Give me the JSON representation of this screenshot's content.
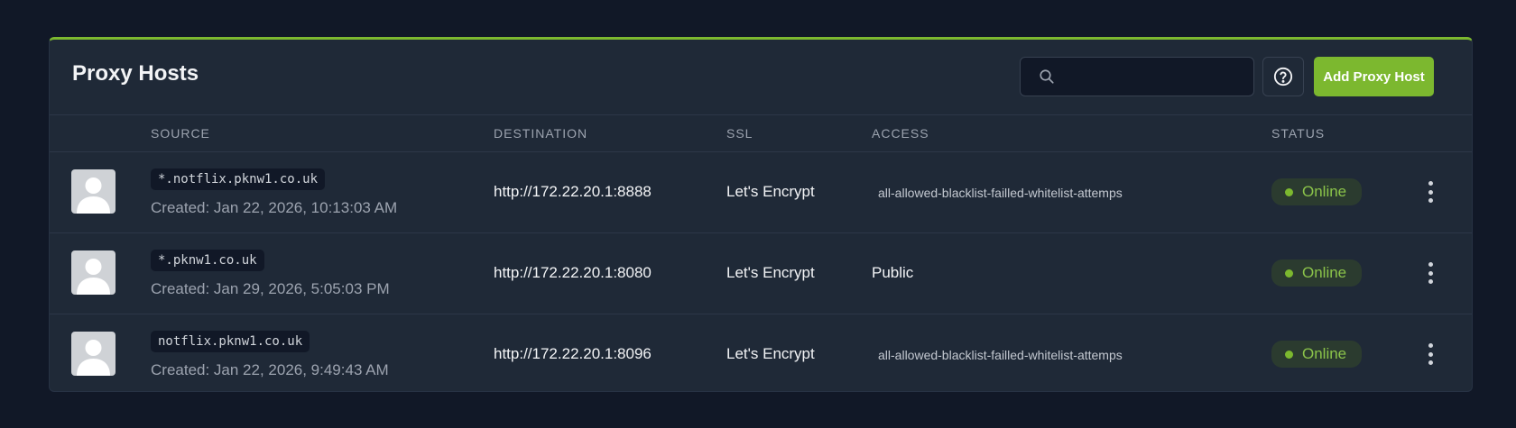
{
  "page": {
    "title": "Proxy Hosts",
    "search_placeholder": "",
    "add_button_label": "Add Proxy Host"
  },
  "table": {
    "headers": {
      "source": "SOURCE",
      "destination": "DESTINATION",
      "ssl": "SSL",
      "access": "ACCESS",
      "status": "STATUS"
    },
    "rows": [
      {
        "domain": "*.notflix.pknw1.co.uk",
        "created": "Created: Jan 22, 2026, 10:13:03 AM",
        "destination": "http://172.22.20.1:8888",
        "ssl": "Let's Encrypt",
        "access": "all-allowed-blacklist-failled-whitelist-attemps",
        "status": "Online"
      },
      {
        "domain": "*.pknw1.co.uk",
        "created": "Created: Jan 29, 2026, 5:05:03 PM",
        "destination": "http://172.22.20.1:8080",
        "ssl": "Let's Encrypt",
        "access": "Public",
        "status": "Online"
      },
      {
        "domain": "notflix.pknw1.co.uk",
        "created": "Created: Jan 22, 2026, 9:49:43 AM",
        "destination": "http://172.22.20.1:8096",
        "ssl": "Let's Encrypt",
        "access": "all-allowed-blacklist-failled-whitelist-attemps",
        "status": "Online"
      }
    ]
  },
  "colors": {
    "accent": "#7cb82f",
    "background": "#111827",
    "card": "#1f2937",
    "status_online": "#8bc34a"
  },
  "icons": {
    "search": "search-icon",
    "help": "help-circle-icon",
    "row_menu": "more-vertical-icon",
    "avatar": "user-avatar-placeholder-icon"
  }
}
